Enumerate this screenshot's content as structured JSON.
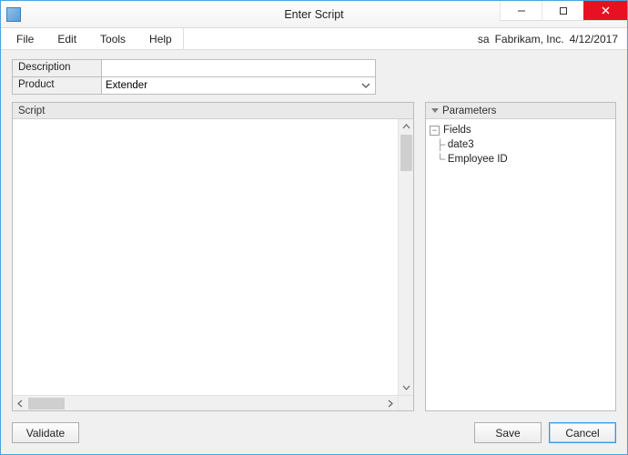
{
  "window": {
    "title": "Enter Script"
  },
  "menus": {
    "file": "File",
    "edit": "Edit",
    "tools": "Tools",
    "help": "Help"
  },
  "status": {
    "user": "sa",
    "company": "Fabrikam, Inc.",
    "date": "4/12/2017"
  },
  "form": {
    "description_label": "Description",
    "description_value": "",
    "product_label": "Product",
    "product_value": "Extender"
  },
  "panels": {
    "script_header": "Script",
    "params_header": "Parameters",
    "script_value": ""
  },
  "tree": {
    "root": "Fields",
    "children": [
      "date3",
      "Employee ID"
    ]
  },
  "buttons": {
    "validate": "Validate",
    "save": "Save",
    "cancel": "Cancel"
  }
}
